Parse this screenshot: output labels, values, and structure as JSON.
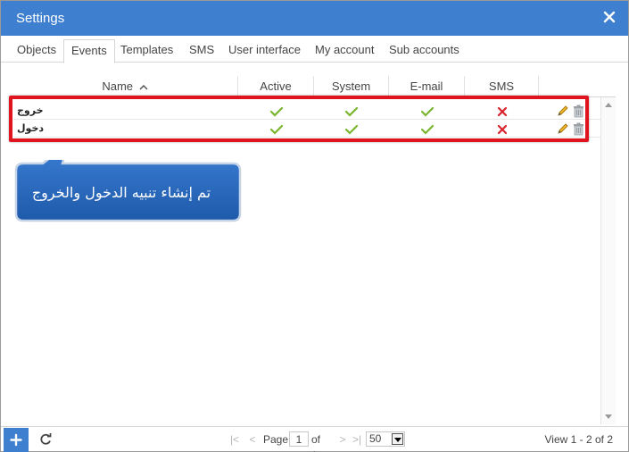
{
  "window": {
    "title": "Settings"
  },
  "tabs": [
    {
      "label": "Objects"
    },
    {
      "label": "Events"
    },
    {
      "label": "Templates"
    },
    {
      "label": "SMS"
    },
    {
      "label": "User interface"
    },
    {
      "label": "My account"
    },
    {
      "label": "Sub accounts"
    }
  ],
  "active_tab": "Events",
  "grid": {
    "columns": [
      {
        "label": "Name",
        "sort": "ascending"
      },
      {
        "label": "Active"
      },
      {
        "label": "System"
      },
      {
        "label": "E-mail"
      },
      {
        "label": "SMS"
      },
      {
        "label": ""
      }
    ],
    "rows": [
      {
        "name": "خروج",
        "active": true,
        "system": true,
        "email": true,
        "sms": false
      },
      {
        "name": "دخول",
        "active": true,
        "system": true,
        "email": true,
        "sms": false
      }
    ]
  },
  "callout": {
    "text": "تم إنشاء تنبيه الدخول والخروج"
  },
  "pager": {
    "page_label": "Page",
    "page_value": "1",
    "of_label": "of 1",
    "page_size": "50",
    "view_info": "View 1 - 2 of 2"
  },
  "colors": {
    "titlebar": "#3e7fd0",
    "check": "#7ab52f",
    "cross": "#d9232d",
    "highlight": "#e0141e",
    "callout": "#2d6cc0"
  },
  "icons": {
    "close": "close-icon",
    "sort": "sort-asc-icon",
    "check": "check-icon",
    "cross": "cross-icon",
    "edit": "pencil-icon",
    "delete": "trash-icon",
    "add": "plus-icon",
    "refresh": "refresh-icon"
  }
}
